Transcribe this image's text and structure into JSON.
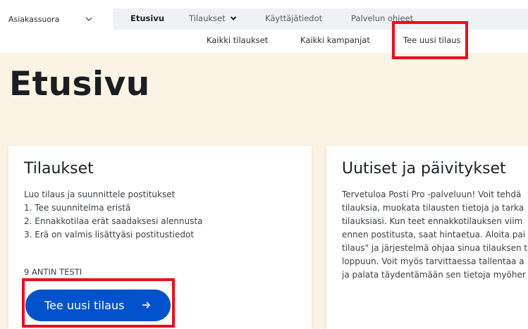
{
  "header": {
    "account_selector": {
      "value": "Asiakassuora",
      "icon": "chevron-down-icon"
    },
    "primary_nav": [
      {
        "label": "Etusivu",
        "active": true
      },
      {
        "label": "Tilaukset",
        "has_dropdown": true,
        "icon": "caret-down-icon"
      },
      {
        "label": "Käyttäjätiedot"
      },
      {
        "label": "Palvelun ohjeet"
      }
    ],
    "sub_nav": [
      {
        "label": "Kaikki tilaukset"
      },
      {
        "label": "Kaikki kampanjat"
      },
      {
        "label": "Tee uusi tilaus",
        "highlighted": true
      }
    ]
  },
  "main": {
    "page_title": "Etusivu",
    "orders_card": {
      "title": "Tilaukset",
      "steps": [
        "Luo tilaus ja suunnittele postitukset",
        "1. Tee suunnitelma eristä",
        "2. Ennakkotilaa erät saadaksesi alennusta",
        "3. Erä on valmis lisättyäsi postitustiedot"
      ],
      "test_label": "9 ANTIN TESTI",
      "cta_label": "Tee uusi tilaus",
      "cta_icon": "arrow-right-icon",
      "cta_highlighted": true
    },
    "news_card": {
      "title": "Uutiset ja päivitykset",
      "lines": [
        "Tervetuloa Posti Pro -palveluun! Voit tehdä",
        "tilauksia, muokata tilausten tietoja ja tarka",
        "tilauksiasi. Kun teet ennakkotilauksen viim",
        "ennen postitusta, saat hintaetua. Aloita pai",
        "tilaus\" ja järjestelmä ohjaa sinua tilauksen t",
        "loppuun. Voit myös tarvittaessa tallentaa a",
        "ja palata täydentämään sen tietoja myöher"
      ]
    }
  },
  "colors": {
    "page_background": "#fbf3e4",
    "nav_background": "#f0f1f4",
    "primary_button": "#0052cc",
    "highlight_box": "#e8101c"
  }
}
